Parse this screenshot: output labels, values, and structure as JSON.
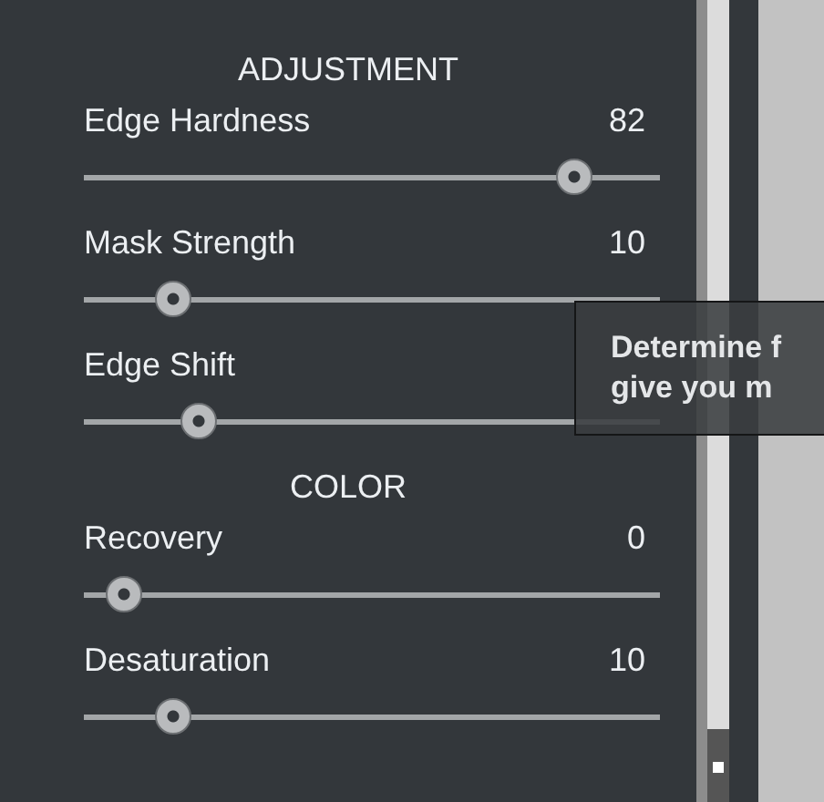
{
  "sections": [
    {
      "title": "ADJUSTMENT",
      "sliders": [
        {
          "label": "Edge Hardness",
          "value": "82",
          "level": 0.85
        },
        {
          "label": "Mask Strength",
          "value": "10",
          "level": 0.155
        },
        {
          "label": "Edge Shift",
          "level": 0.2
        }
      ]
    },
    {
      "title": "COLOR",
      "sliders": [
        {
          "label": "Recovery",
          "value": "0",
          "level": 0.07
        },
        {
          "label": "Desaturation",
          "value": "10",
          "level": 0.155
        }
      ]
    }
  ],
  "tooltip": {
    "lines": [
      "Determine f",
      "give you m"
    ]
  }
}
